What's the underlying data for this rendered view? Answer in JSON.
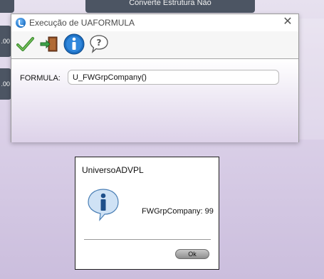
{
  "background": {
    "top_button_label": "Converte Estrutura    Não",
    "side_values": [
      ".00",
      ".00"
    ]
  },
  "window": {
    "title": "Execução de UAFORMULA",
    "close_glyph": "✕",
    "toolbar": {
      "buttons": [
        {
          "name": "confirm-check-icon"
        },
        {
          "name": "exit-door-icon"
        },
        {
          "name": "info-icon"
        },
        {
          "name": "help-icon"
        }
      ]
    },
    "form": {
      "formula_label": "FORMULA:",
      "formula_value": "U_FWGrpCompany()"
    }
  },
  "message_box": {
    "title": "UniversoADVPL",
    "icon": "info-icon",
    "message": "FWGrpCompany: 99",
    "ok_label": "Ok"
  },
  "colors": {
    "desktop": "#d8cde6",
    "background_panels": "#4c5563",
    "check_green": "#3c8d2f",
    "info_blue": "#1d6fc2"
  }
}
